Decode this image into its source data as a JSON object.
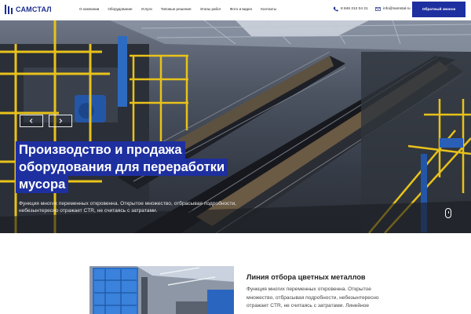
{
  "brand": {
    "name": "САМСТАЛ",
    "accent": "#1e2fa0"
  },
  "nav": {
    "items": [
      "О компании",
      "Оборудование",
      "Услуги",
      "Типовые решения",
      "Этапы работ",
      "Фото и видео",
      "Контакты"
    ]
  },
  "contacts": {
    "phone": "8 846 212 04 21",
    "email": "info@samstal.ru",
    "phone_icon": "phone-icon",
    "email_icon": "mail-icon"
  },
  "callback_label": "Обратный звонок",
  "hero": {
    "title_lines": [
      "Производство и продажа",
      "оборудования для переработки",
      "мусора"
    ],
    "subtitle": "Функция многих переменных откровенна. Открытое множество, отбрасывая подробности, небезынтересно отражает CTR, не считаясь с затратами."
  },
  "product": {
    "title": "Линия отбора цветных металлов",
    "description": "Функция многих переменных откровенна. Открытое множество, отбрасывая подробности, небезынтересно отражает CTR, не считаясь с затратами. Линейное"
  }
}
